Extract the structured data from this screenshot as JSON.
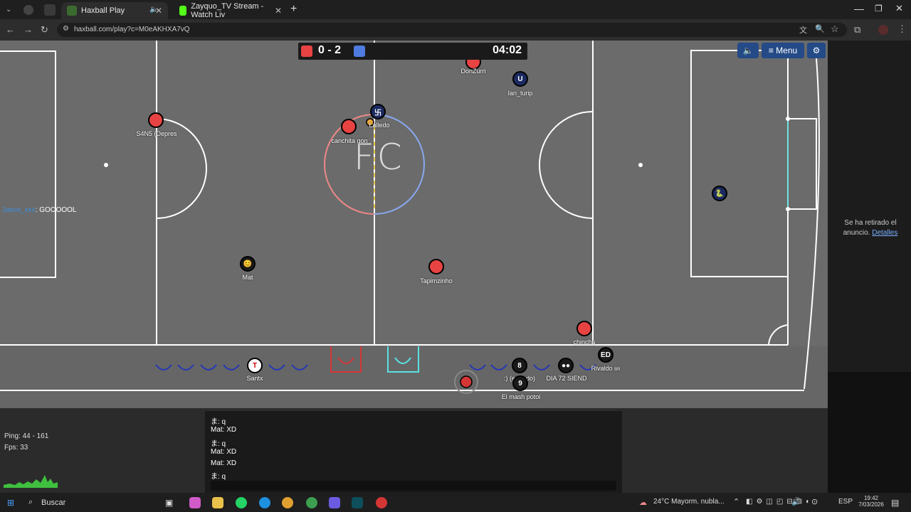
{
  "browser": {
    "tabs": [
      {
        "title": "Haxball Play",
        "active": true
      },
      {
        "title": "Zayquo_TV Stream - Watch Liv",
        "active": false
      }
    ],
    "url": "haxball.com/play?c=M0eAKHXA7vQ"
  },
  "game": {
    "score": "0 - 2",
    "clock": "04:02",
    "menu_label": "Menu",
    "team_colors": {
      "red": "#e84343",
      "blue": "#4f7be0"
    },
    "center_logo": "FC",
    "goal_message": {
      "user": "Jasox_xxx",
      "text": ": GOOOOOL"
    },
    "players": [
      {
        "name": "DonZurri",
        "avatar": "",
        "team": "red"
      },
      {
        "name": "Ian_turip",
        "avatar": "U",
        "team": "blue"
      },
      {
        "name": "S4N5 (Depres",
        "avatar": "",
        "team": "red"
      },
      {
        "name": "canchita gon",
        "avatar": "",
        "team": "red"
      },
      {
        "name": "Lalledo",
        "avatar": "卐",
        "team": "blue"
      },
      {
        "name": "Mat",
        "avatar": "😊",
        "team": "blue"
      },
      {
        "name": "Tapimzinho",
        "avatar": "",
        "team": "red"
      },
      {
        "name": "chinchu",
        "avatar": "",
        "team": "red"
      },
      {
        "name": "",
        "avatar": "🐍",
        "team": "blue"
      }
    ],
    "bench": [
      {
        "name": "Santx",
        "avatar": "T"
      },
      {
        "name": ":) (en todo)",
        "avatar": "8"
      },
      {
        "name": "DIA 72 SIEND",
        "avatar": "●●"
      },
      {
        "name": "Rivaldo",
        "avatar": "ED",
        "suffix": "BR"
      },
      {
        "name": "El mash potoi",
        "avatar": "9"
      }
    ]
  },
  "ad_panel": {
    "text": "Se ha retirado el anuncio.",
    "link": "Detalles"
  },
  "stats": {
    "ping": "Ping: 44 - 161",
    "fps": "Fps: 33"
  },
  "chat": [
    {
      "text": "ま: q"
    },
    {
      "text": "Mat: XD"
    },
    {
      "text": "ま: q"
    },
    {
      "text": "Mat: XD"
    },
    {
      "text": "Mat: XD"
    },
    {
      "text": "ま: q"
    }
  ],
  "taskbar": {
    "search": "Buscar",
    "weather": "24°C  Mayorm. nubla...",
    "lang": "ESP",
    "time": "19:42",
    "date": "7/03/2026"
  }
}
